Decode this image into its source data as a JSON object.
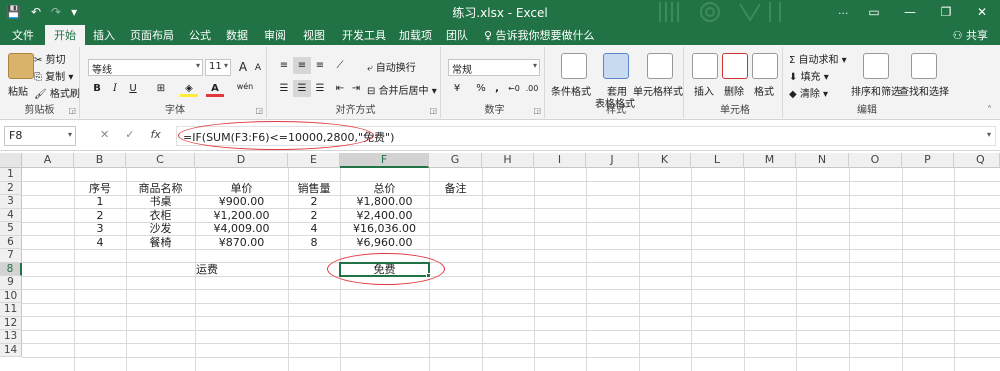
{
  "titlebar": {
    "title": "练习.xlsx  -  Excel",
    "user": "...",
    "qat": {
      "save": "💾",
      "undo": "↶",
      "redo": "↷",
      "more": "▾"
    },
    "controls": {
      "ribbon_display": "▭",
      "minimize": "—",
      "restore": "❐",
      "close": "✕"
    }
  },
  "tabs": [
    "文件",
    "开始",
    "插入",
    "页面布局",
    "公式",
    "数据",
    "审阅",
    "视图",
    "开发工具",
    "加载项",
    "团队"
  ],
  "tellme": "♀ 告诉我你想要做什么",
  "share": "共享",
  "ribbon": {
    "clipboard": {
      "paste": "粘贴",
      "cut": "剪切",
      "copy": "复制",
      "format_painter": "格式刷",
      "label": "剪贴板"
    },
    "font": {
      "name": "等线",
      "size": "11",
      "grow": "A",
      "shrink": "A",
      "bold": "B",
      "italic": "I",
      "underline": "U",
      "wen": "wén",
      "label": "字体"
    },
    "alignment": {
      "wrap": "自动换行",
      "merge": "合并后居中",
      "label": "对齐方式"
    },
    "number": {
      "format": "常规",
      "currency": "¥",
      "percent": "%",
      "comma": ",",
      "inc": "←0",
      "dec": ".00",
      "label": "数字"
    },
    "styles": {
      "cond": "条件格式",
      "table": "套用",
      "table2": "表格格式",
      "cell": "单元格样式",
      "label": "样式"
    },
    "cells": {
      "insert": "插入",
      "delete": "删除",
      "format": "格式",
      "label": "单元格"
    },
    "editing": {
      "autosum": "自动求和",
      "fill": "填充",
      "clear": "清除",
      "sort": "排序和筛选",
      "find": "查找和选择",
      "label": "编辑"
    }
  },
  "formula_bar": {
    "name_box": "F8",
    "cancel": "✕",
    "enter": "✓",
    "fx": "fx",
    "formula": "=IF(SUM(F3:F6)<=10000,2800,\"免费\")"
  },
  "grid": {
    "columns": [
      "A",
      "B",
      "C",
      "D",
      "E",
      "F",
      "G",
      "H",
      "I",
      "J",
      "K",
      "L",
      "M",
      "N",
      "O",
      "P",
      "Q"
    ],
    "rows": [
      "1",
      "2",
      "3",
      "4",
      "5",
      "6",
      "7",
      "8",
      "9",
      "10",
      "11",
      "12",
      "13",
      "14"
    ],
    "headers": {
      "seq": "序号",
      "name": "商品名称",
      "price": "单价",
      "qty": "销售量",
      "total": "总价",
      "note": "备注"
    },
    "items": [
      {
        "seq": "1",
        "name": "书桌",
        "price": "¥900.00",
        "qty": "2",
        "total": "¥1,800.00"
      },
      {
        "seq": "2",
        "name": "衣柜",
        "price": "¥1,200.00",
        "qty": "2",
        "total": "¥2,400.00"
      },
      {
        "seq": "3",
        "name": "沙发",
        "price": "¥4,009.00",
        "qty": "4",
        "total": "¥16,036.00"
      },
      {
        "seq": "4",
        "name": "餐椅",
        "price": "¥870.00",
        "qty": "8",
        "total": "¥6,960.00"
      }
    ],
    "shipping_label": "运费",
    "shipping_value": "免费"
  },
  "colors": {
    "excel_green": "#217346",
    "annotation_red": "#e0393e"
  }
}
